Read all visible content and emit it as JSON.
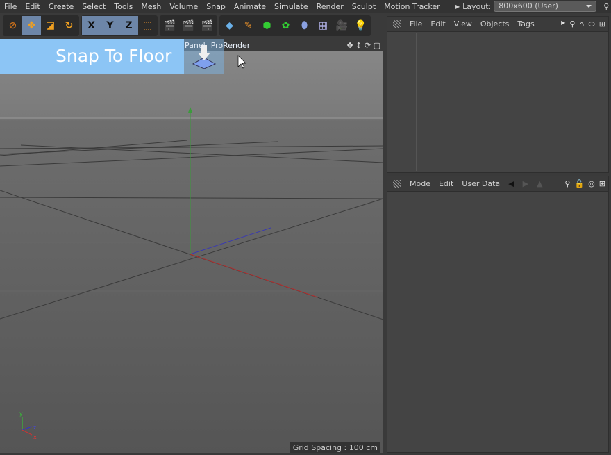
{
  "menu": [
    "File",
    "Edit",
    "Create",
    "Select",
    "Tools",
    "Mesh",
    "Volume",
    "Snap",
    "Animate",
    "Simulate",
    "Render",
    "Sculpt",
    "Motion Tracker"
  ],
  "layout": {
    "label": "Layout:",
    "value": "800x600 (User)"
  },
  "toolbar": {
    "axis_x": "X",
    "axis_y": "Y",
    "axis_z": "Z"
  },
  "viewport": {
    "tabs": [
      "Panel",
      "ProRender"
    ],
    "grid_spacing": "Grid Spacing : 100 cm"
  },
  "overlay": {
    "title": "Snap To Floor"
  },
  "object_manager": {
    "menu": [
      "File",
      "Edit",
      "View",
      "Objects",
      "Tags"
    ]
  },
  "attribute_manager": {
    "menu": [
      "Mode",
      "Edit",
      "User Data"
    ]
  }
}
